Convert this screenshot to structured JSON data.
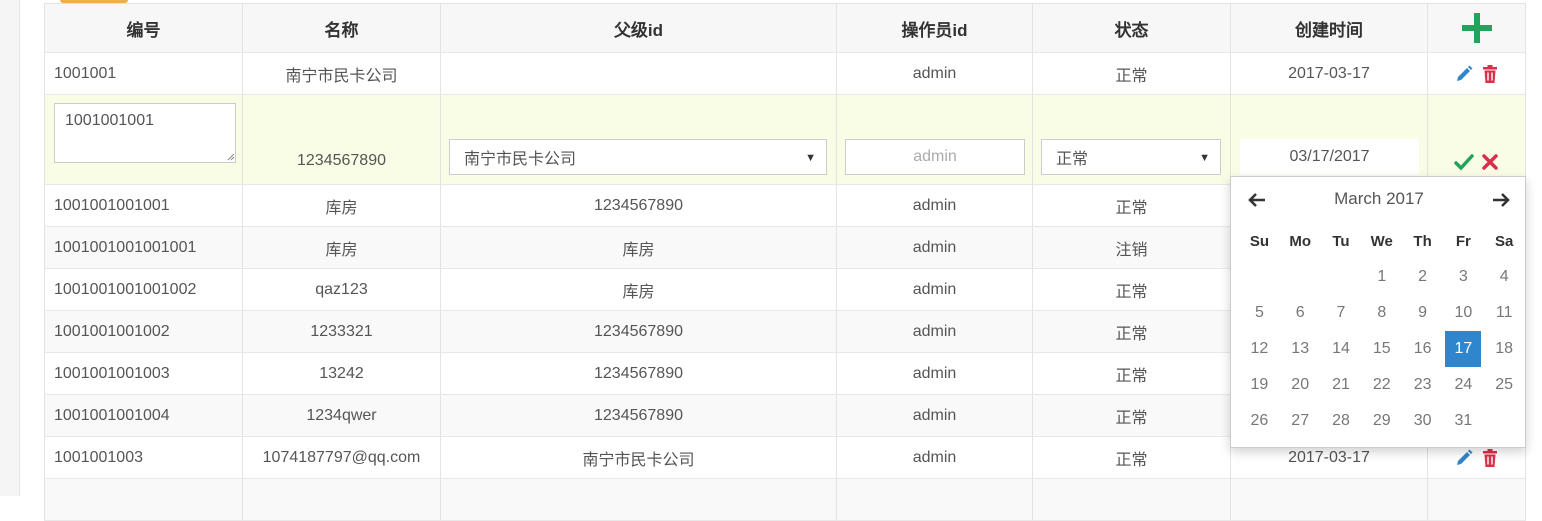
{
  "colors": {
    "accent_green": "#22a35b",
    "edit_blue": "#2f86cc",
    "delete_red": "#d9304a",
    "edit_row_bg": "#fafde6",
    "selected_day": "#2f86cc"
  },
  "table": {
    "headers": [
      "编号",
      "名称",
      "父级id",
      "操作员id",
      "状态",
      "创建时间"
    ],
    "rows": [
      {
        "id": "1001001",
        "name": "南宁市民卡公司",
        "parent": "",
        "operator": "admin",
        "status": "正常",
        "created": "2017-03-17"
      },
      {
        "id": "1001001001001",
        "name": "库房",
        "parent": "1234567890",
        "operator": "admin",
        "status": "正常",
        "created": ""
      },
      {
        "id": "1001001001001001",
        "name": "库房",
        "parent": "库房",
        "operator": "admin",
        "status": "注销",
        "created": ""
      },
      {
        "id": "1001001001001002",
        "name": "qaz123",
        "parent": "库房",
        "operator": "admin",
        "status": "正常",
        "created": ""
      },
      {
        "id": "1001001001002",
        "name": "1233321",
        "parent": "1234567890",
        "operator": "admin",
        "status": "正常",
        "created": ""
      },
      {
        "id": "1001001001003",
        "name": "13242",
        "parent": "1234567890",
        "operator": "admin",
        "status": "正常",
        "created": ""
      },
      {
        "id": "1001001001004",
        "name": "1234qwer",
        "parent": "1234567890",
        "operator": "admin",
        "status": "正常",
        "created": ""
      },
      {
        "id": "1001001003",
        "name": "1074187797@qq.com",
        "parent": "南宁市民卡公司",
        "operator": "admin",
        "status": "正常",
        "created": "2017-03-17"
      }
    ],
    "edit_row": {
      "id_value": "1001001001",
      "name_value": "1234567890",
      "parent_selected": "南宁市民卡公司",
      "operator_placeholder": "admin",
      "status_selected": "正常",
      "created_value": "03/17/2017"
    }
  },
  "icons": {
    "add": "plus-icon",
    "edit": "pencil-icon",
    "delete": "trash-icon",
    "save": "check-icon",
    "cancel": "close-icon",
    "select_arrow": "▼",
    "prev": "arrow-left-icon",
    "next": "arrow-right-icon"
  },
  "calendar": {
    "title": "March 2017",
    "weekdays": [
      "Su",
      "Mo",
      "Tu",
      "We",
      "Th",
      "Fr",
      "Sa"
    ],
    "weeks": [
      [
        "",
        "",
        "",
        "1",
        "2",
        "3",
        "4"
      ],
      [
        "5",
        "6",
        "7",
        "8",
        "9",
        "10",
        "11"
      ],
      [
        "12",
        "13",
        "14",
        "15",
        "16",
        "17",
        "18"
      ],
      [
        "19",
        "20",
        "21",
        "22",
        "23",
        "24",
        "25"
      ],
      [
        "26",
        "27",
        "28",
        "29",
        "30",
        "31",
        ""
      ]
    ],
    "selected_day": "17"
  }
}
